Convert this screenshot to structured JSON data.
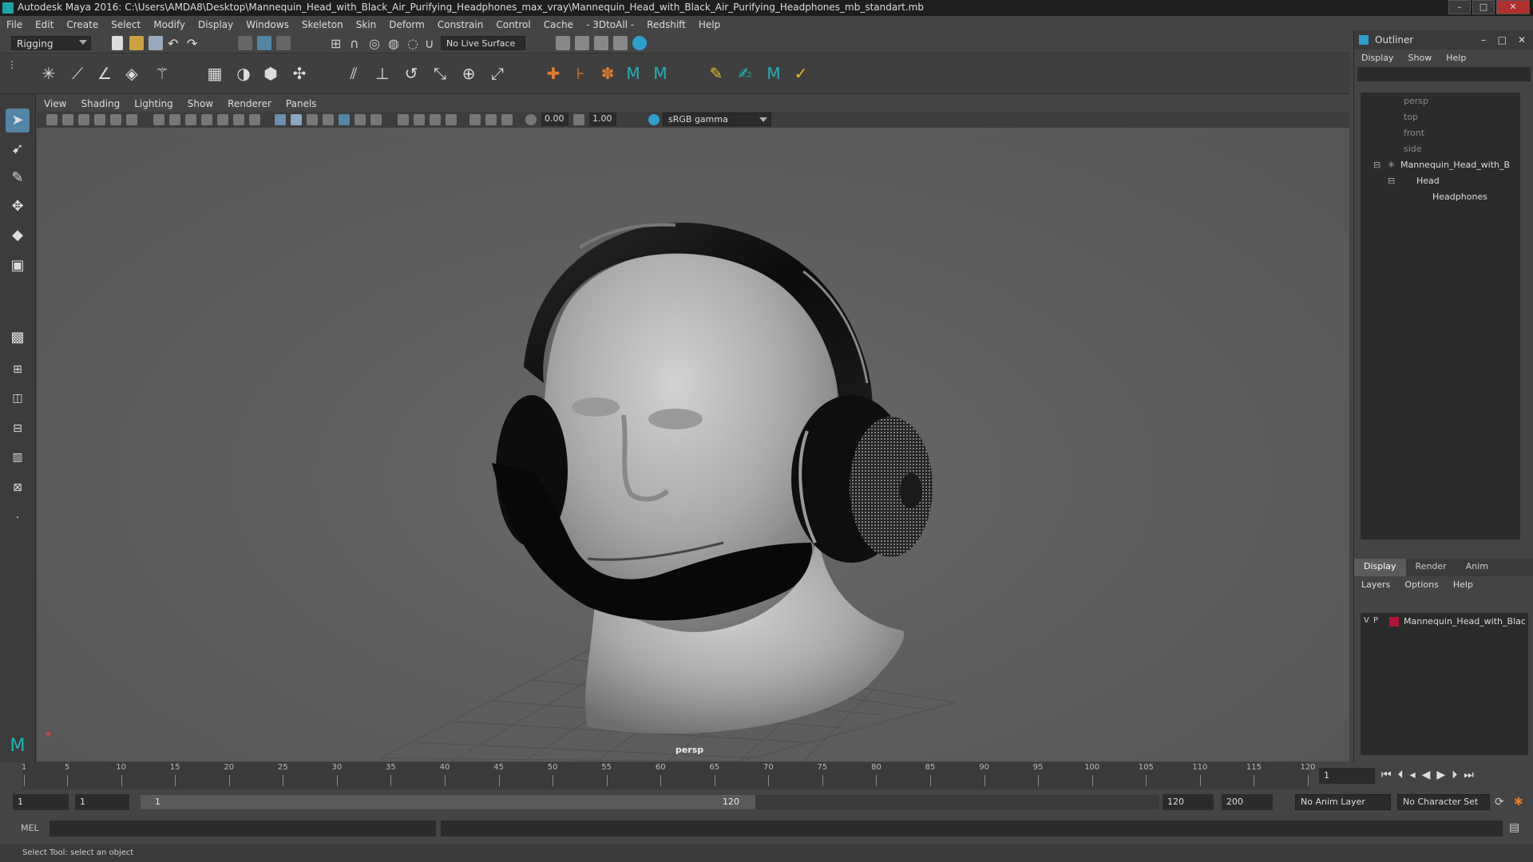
{
  "window": {
    "title": "Autodesk Maya 2016: C:\\Users\\AMDA8\\Desktop\\Mannequin_Head_with_Black_Air_Purifying_Headphones_max_vray\\Mannequin_Head_with_Black_Air_Purifying_Headphones_mb_standart.mb",
    "btn_minimize": "–",
    "btn_maximize": "□",
    "btn_close": "✕"
  },
  "menubar": [
    "File",
    "Edit",
    "Create",
    "Select",
    "Modify",
    "Display",
    "Windows",
    "Skeleton",
    "Skin",
    "Deform",
    "Constrain",
    "Control",
    "Cache",
    "- 3DtoAll -",
    "Redshift",
    "Help"
  ],
  "statusline": {
    "mode": "Rigging",
    "live_surface": "No Live Surface"
  },
  "panel": {
    "menus": [
      "View",
      "Shading",
      "Lighting",
      "Show",
      "Renderer",
      "Panels"
    ],
    "exposure": "0.00",
    "gamma": "1.00",
    "colorspace": "sRGB gamma",
    "camera": "persp"
  },
  "outliner": {
    "title": "Outliner",
    "menus": [
      "Display",
      "Show",
      "Help"
    ],
    "items": [
      "persp",
      "top",
      "front",
      "side",
      "Mannequin_Head_with_B",
      "Head",
      "Headphones"
    ]
  },
  "layer_editor": {
    "tabs": [
      "Display",
      "Render",
      "Anim"
    ],
    "menus": [
      "Layers",
      "Options",
      "Help"
    ],
    "layer": {
      "v": "V",
      "p": "P",
      "name": "Mannequin_Head_with_Blac",
      "color": "#b0163a"
    }
  },
  "timeline": {
    "ticks": [
      1,
      5,
      10,
      15,
      20,
      25,
      30,
      35,
      40,
      45,
      50,
      55,
      60,
      65,
      70,
      75,
      80,
      85,
      90,
      95,
      100,
      105,
      110,
      115,
      120
    ],
    "current_frame": "1"
  },
  "range": {
    "start": "1",
    "playback_start": "1",
    "slider_start": "1",
    "slider_end": "120",
    "playback_end": "120",
    "end": "200",
    "anim_layer": "No Anim Layer",
    "character_set": "No Character Set"
  },
  "cmdline": {
    "label": "MEL"
  },
  "helpline": {
    "text": "Select Tool: select an object"
  }
}
